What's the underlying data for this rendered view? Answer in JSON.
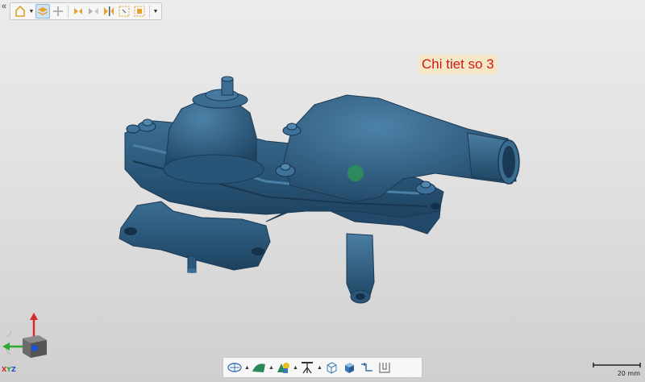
{
  "viewport": {
    "annotation_label": "Chi tiet so 3",
    "model_color": "#2f5c7e",
    "marker_color": "#2e8f5a"
  },
  "top_toolbar": {
    "collapse_glyph": "«",
    "buttons": [
      {
        "icon": "home-view-icon"
      },
      {
        "icon": "dropdown-caret-icon"
      },
      {
        "icon": "layers-icon",
        "active": true
      },
      {
        "icon": "move-icon"
      },
      {
        "icon": "flip-icon"
      },
      {
        "icon": "flip-rotate-icon"
      },
      {
        "icon": "mirror-icon"
      },
      {
        "icon": "fit-selection-icon"
      },
      {
        "icon": "fit-all-icon"
      },
      {
        "icon": "dropdown-caret-icon"
      }
    ]
  },
  "bottom_toolbar": {
    "buttons": [
      {
        "icon": "mesh-shading-icon"
      },
      {
        "icon": "surface-color-icon"
      },
      {
        "icon": "color-shapes-icon"
      },
      {
        "icon": "tripod-light-icon"
      },
      {
        "icon": "wireframe-cube-icon"
      },
      {
        "icon": "solid-cube-icon"
      },
      {
        "icon": "section-step-icon"
      },
      {
        "icon": "cross-section-icon"
      }
    ]
  },
  "scale": {
    "label": "20 mm"
  },
  "axis": {
    "x_label": "X",
    "y_label": "Y",
    "z_label": "Z",
    "x_color": "#d82a2a",
    "y_color": "#2faa2f",
    "z_color": "#1f4fd8"
  }
}
